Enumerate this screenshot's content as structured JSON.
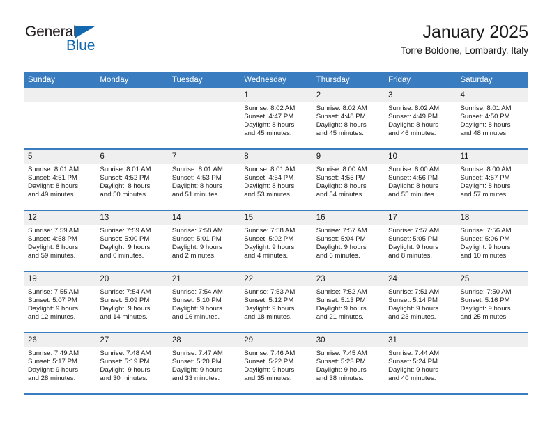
{
  "brand": {
    "name_part1": "General",
    "name_part2": "Blue",
    "logo_icon": "blue-triangle-icon",
    "colors": {
      "accent": "#1269b0",
      "text": "#231f20"
    }
  },
  "header": {
    "title": "January 2025",
    "subtitle": "Torre Boldone, Lombardy, Italy"
  },
  "calendar": {
    "header_bg": "#3a7cc0",
    "daynum_bg": "#efefef",
    "weekday_headers": [
      "Sunday",
      "Monday",
      "Tuesday",
      "Wednesday",
      "Thursday",
      "Friday",
      "Saturday"
    ],
    "weeks": [
      [
        {
          "day": "",
          "lines": []
        },
        {
          "day": "",
          "lines": []
        },
        {
          "day": "",
          "lines": []
        },
        {
          "day": "1",
          "lines": [
            "Sunrise: 8:02 AM",
            "Sunset: 4:47 PM",
            "Daylight: 8 hours",
            "and 45 minutes."
          ]
        },
        {
          "day": "2",
          "lines": [
            "Sunrise: 8:02 AM",
            "Sunset: 4:48 PM",
            "Daylight: 8 hours",
            "and 45 minutes."
          ]
        },
        {
          "day": "3",
          "lines": [
            "Sunrise: 8:02 AM",
            "Sunset: 4:49 PM",
            "Daylight: 8 hours",
            "and 46 minutes."
          ]
        },
        {
          "day": "4",
          "lines": [
            "Sunrise: 8:01 AM",
            "Sunset: 4:50 PM",
            "Daylight: 8 hours",
            "and 48 minutes."
          ]
        }
      ],
      [
        {
          "day": "5",
          "lines": [
            "Sunrise: 8:01 AM",
            "Sunset: 4:51 PM",
            "Daylight: 8 hours",
            "and 49 minutes."
          ]
        },
        {
          "day": "6",
          "lines": [
            "Sunrise: 8:01 AM",
            "Sunset: 4:52 PM",
            "Daylight: 8 hours",
            "and 50 minutes."
          ]
        },
        {
          "day": "7",
          "lines": [
            "Sunrise: 8:01 AM",
            "Sunset: 4:53 PM",
            "Daylight: 8 hours",
            "and 51 minutes."
          ]
        },
        {
          "day": "8",
          "lines": [
            "Sunrise: 8:01 AM",
            "Sunset: 4:54 PM",
            "Daylight: 8 hours",
            "and 53 minutes."
          ]
        },
        {
          "day": "9",
          "lines": [
            "Sunrise: 8:00 AM",
            "Sunset: 4:55 PM",
            "Daylight: 8 hours",
            "and 54 minutes."
          ]
        },
        {
          "day": "10",
          "lines": [
            "Sunrise: 8:00 AM",
            "Sunset: 4:56 PM",
            "Daylight: 8 hours",
            "and 55 minutes."
          ]
        },
        {
          "day": "11",
          "lines": [
            "Sunrise: 8:00 AM",
            "Sunset: 4:57 PM",
            "Daylight: 8 hours",
            "and 57 minutes."
          ]
        }
      ],
      [
        {
          "day": "12",
          "lines": [
            "Sunrise: 7:59 AM",
            "Sunset: 4:58 PM",
            "Daylight: 8 hours",
            "and 59 minutes."
          ]
        },
        {
          "day": "13",
          "lines": [
            "Sunrise: 7:59 AM",
            "Sunset: 5:00 PM",
            "Daylight: 9 hours",
            "and 0 minutes."
          ]
        },
        {
          "day": "14",
          "lines": [
            "Sunrise: 7:58 AM",
            "Sunset: 5:01 PM",
            "Daylight: 9 hours",
            "and 2 minutes."
          ]
        },
        {
          "day": "15",
          "lines": [
            "Sunrise: 7:58 AM",
            "Sunset: 5:02 PM",
            "Daylight: 9 hours",
            "and 4 minutes."
          ]
        },
        {
          "day": "16",
          "lines": [
            "Sunrise: 7:57 AM",
            "Sunset: 5:04 PM",
            "Daylight: 9 hours",
            "and 6 minutes."
          ]
        },
        {
          "day": "17",
          "lines": [
            "Sunrise: 7:57 AM",
            "Sunset: 5:05 PM",
            "Daylight: 9 hours",
            "and 8 minutes."
          ]
        },
        {
          "day": "18",
          "lines": [
            "Sunrise: 7:56 AM",
            "Sunset: 5:06 PM",
            "Daylight: 9 hours",
            "and 10 minutes."
          ]
        }
      ],
      [
        {
          "day": "19",
          "lines": [
            "Sunrise: 7:55 AM",
            "Sunset: 5:07 PM",
            "Daylight: 9 hours",
            "and 12 minutes."
          ]
        },
        {
          "day": "20",
          "lines": [
            "Sunrise: 7:54 AM",
            "Sunset: 5:09 PM",
            "Daylight: 9 hours",
            "and 14 minutes."
          ]
        },
        {
          "day": "21",
          "lines": [
            "Sunrise: 7:54 AM",
            "Sunset: 5:10 PM",
            "Daylight: 9 hours",
            "and 16 minutes."
          ]
        },
        {
          "day": "22",
          "lines": [
            "Sunrise: 7:53 AM",
            "Sunset: 5:12 PM",
            "Daylight: 9 hours",
            "and 18 minutes."
          ]
        },
        {
          "day": "23",
          "lines": [
            "Sunrise: 7:52 AM",
            "Sunset: 5:13 PM",
            "Daylight: 9 hours",
            "and 21 minutes."
          ]
        },
        {
          "day": "24",
          "lines": [
            "Sunrise: 7:51 AM",
            "Sunset: 5:14 PM",
            "Daylight: 9 hours",
            "and 23 minutes."
          ]
        },
        {
          "day": "25",
          "lines": [
            "Sunrise: 7:50 AM",
            "Sunset: 5:16 PM",
            "Daylight: 9 hours",
            "and 25 minutes."
          ]
        }
      ],
      [
        {
          "day": "26",
          "lines": [
            "Sunrise: 7:49 AM",
            "Sunset: 5:17 PM",
            "Daylight: 9 hours",
            "and 28 minutes."
          ]
        },
        {
          "day": "27",
          "lines": [
            "Sunrise: 7:48 AM",
            "Sunset: 5:19 PM",
            "Daylight: 9 hours",
            "and 30 minutes."
          ]
        },
        {
          "day": "28",
          "lines": [
            "Sunrise: 7:47 AM",
            "Sunset: 5:20 PM",
            "Daylight: 9 hours",
            "and 33 minutes."
          ]
        },
        {
          "day": "29",
          "lines": [
            "Sunrise: 7:46 AM",
            "Sunset: 5:22 PM",
            "Daylight: 9 hours",
            "and 35 minutes."
          ]
        },
        {
          "day": "30",
          "lines": [
            "Sunrise: 7:45 AM",
            "Sunset: 5:23 PM",
            "Daylight: 9 hours",
            "and 38 minutes."
          ]
        },
        {
          "day": "31",
          "lines": [
            "Sunrise: 7:44 AM",
            "Sunset: 5:24 PM",
            "Daylight: 9 hours",
            "and 40 minutes."
          ]
        },
        {
          "day": "",
          "lines": []
        }
      ]
    ]
  }
}
